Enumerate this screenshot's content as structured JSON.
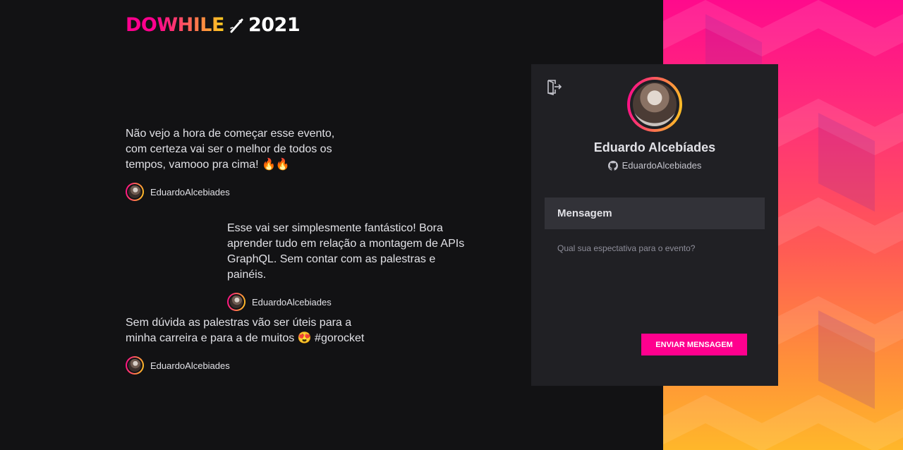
{
  "logo": {
    "part1": "DO",
    "part2": "WHILE",
    "year": "2021"
  },
  "messages": [
    {
      "text": "Não vejo a hora de começar esse evento, com certeza vai ser o melhor de todos os tempos, vamooo pra cima! 🔥🔥",
      "user": "EduardoAlcebiades"
    },
    {
      "text": "Esse vai ser simplesmente fantástico! Bora aprender tudo em relação a montagem de APIs GraphQL. Sem contar com as palestras e painéis.",
      "user": "EduardoAlcebiades"
    },
    {
      "text": "Sem dúvida as palestras vão ser úteis para a minha carreira e para a de muitos 😍 #gorocket",
      "user": "EduardoAlcebiades"
    }
  ],
  "profile": {
    "name": "Eduardo Alcebíades",
    "github": "EduardoAlcebiades"
  },
  "form": {
    "title": "Mensagem",
    "placeholder": "Qual sua espectativa para o evento?",
    "value": "",
    "submit_label": "ENVIAR MENSAGEM"
  },
  "colors": {
    "accent": "#ff008e",
    "yellow": "#ffcd1e",
    "background": "#121214",
    "card": "#202024"
  },
  "icons": {
    "signout": "sign-out-icon",
    "github": "github-icon"
  }
}
